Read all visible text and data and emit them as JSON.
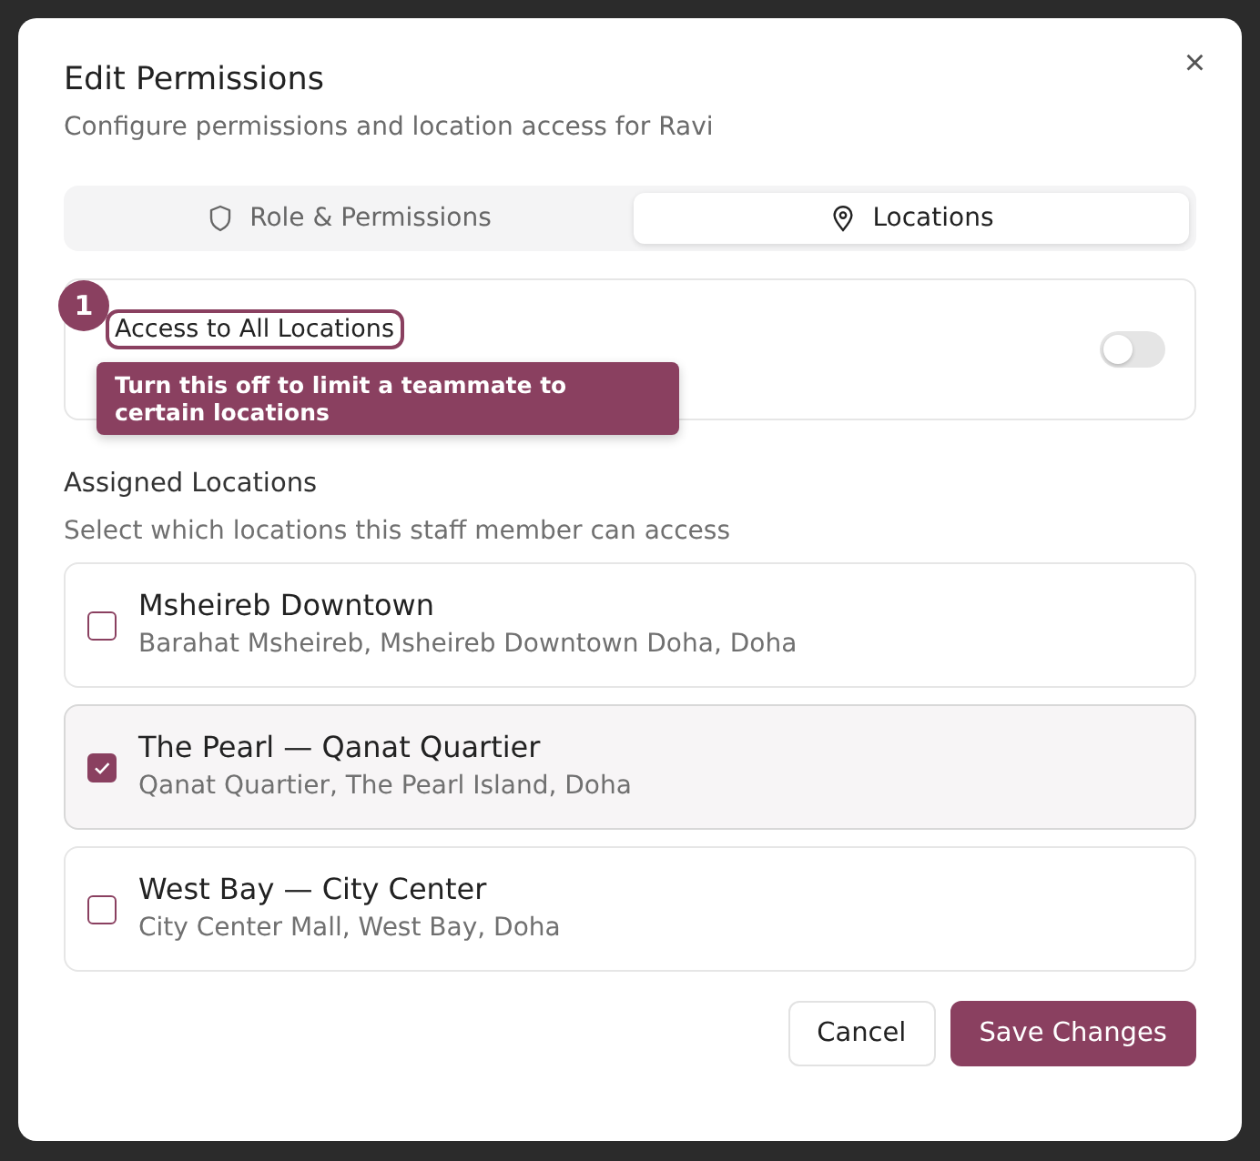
{
  "dialog": {
    "title": "Edit Permissions",
    "subtitle": "Configure permissions and location access for Ravi",
    "close": "×"
  },
  "tabs": [
    {
      "label": "Role & Permissions",
      "selected": false
    },
    {
      "label": "Locations",
      "selected": true
    }
  ],
  "all_locations": {
    "label": "Access to All Locations",
    "on": false,
    "step": "1",
    "tooltip": "Turn this off to limit a teammate to certain locations"
  },
  "assigned": {
    "title": "Assigned Locations",
    "description": "Select which locations this staff member can access"
  },
  "locations": [
    {
      "name": "Msheireb Downtown",
      "address": "Barahat Msheireb, Msheireb Downtown Doha, Doha",
      "checked": false
    },
    {
      "name": "The Pearl — Qanat Quartier",
      "address": "Qanat Quartier, The Pearl Island, Doha",
      "checked": true
    },
    {
      "name": "West Bay — City Center",
      "address": "City Center Mall, West Bay, Doha",
      "checked": false
    }
  ],
  "buttons": [
    {
      "label": "Cancel",
      "kind": "secondary"
    },
    {
      "label": "Save Changes",
      "kind": "primary"
    }
  ]
}
